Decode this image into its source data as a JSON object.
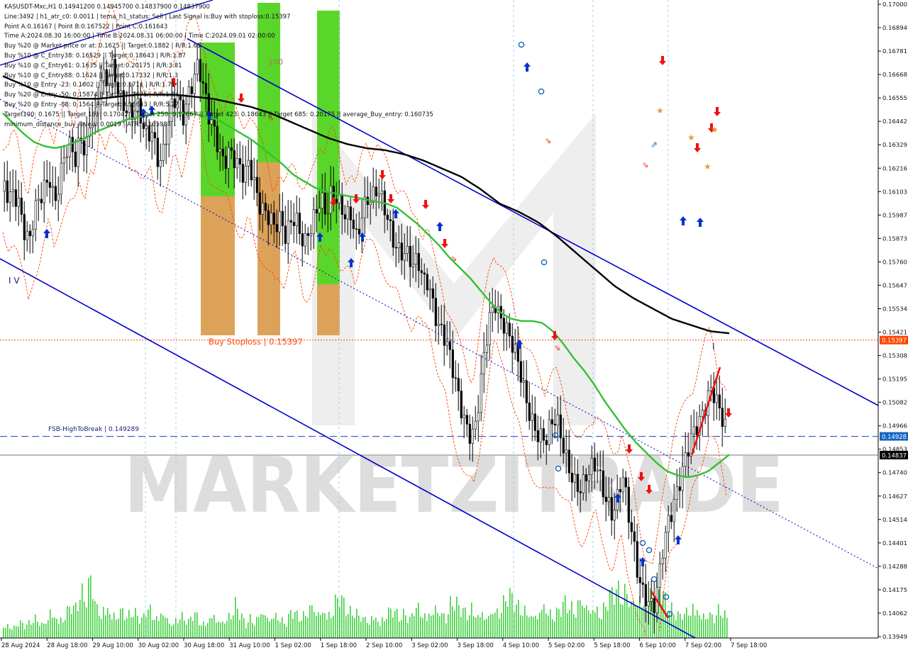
{
  "header": {
    "lines": [
      "KASUSDT-Mxc,H1  0.14941200 0.14945700 0.14837900 0.14837900",
      "Line:3492 | h1_atr_c0: 0.0011 | tema_h1_status: Sell | Last Signal is:Buy with stoploss:0.15397",
      "Point A:0.16167 | Point B:0.167522 | Point C:0.161643",
      "Time A:2024.08.30 16:00:00 | Time B:2024.08.31 06:00:00 | Time C:2024.09.01 02:00:00",
      "Buy %20 @ Market price or at: 0.1625 || Target:0.1882 | R/R:1.61",
      "Buy %10 @ C_Entry38: 0.16529 || Target:0.18643 | R/R:1.87",
      "Buy %10 @ C_Entry61: 0.1635 || Target:0.20175 | R/R:3.81",
      "Buy %10 @ C_Entry88: 0.1624 || Target:0.17332 | R/R:1.3",
      "Buy %10 @ Entry -23: 0.1602 || Target:0.1711 | R/R:1.71",
      "Buy %20 @ Entry -50: 0.15874 || Target:0.1675 | R/R:1.84",
      "Buy %20 @ Entry -88: 0.1564 || Target:0.16643 | R/R:5.27",
      "Target100: 0.1675 || Target 161: 0.17042 || Target 250: 0.17667 || Target 423: 0.18643 || Target 685: 0.20175 || average_Buy_entry: 0.160735",
      "minimum_distance_buy_levels: 0.0019 | ATR: 0.105984"
    ]
  },
  "watermark": {
    "text": "MARKETZITRADE"
  },
  "labels": {
    "buy_stoploss": "Buy Stoploss | 0.15397",
    "fsb": "FSB-HighToBreak | 0.149289",
    "wave_iv": "I V",
    "level_100": "100",
    "wave_i": "I"
  },
  "price_axis": {
    "ticks": [
      "0.17000",
      "0.16894",
      "0.16781",
      "0.16668",
      "0.16555",
      "0.16442",
      "0.16329",
      "0.16216",
      "0.16103",
      "0.15987",
      "0.15873",
      "0.15760",
      "0.15647",
      "0.15534",
      "0.15421",
      "0.15308",
      "0.15195",
      "0.15082",
      "0.14966",
      "0.14853",
      "0.14740",
      "0.14627",
      "0.14514",
      "0.14401",
      "0.14288",
      "0.14175",
      "0.14062",
      "0.13949"
    ],
    "badges": [
      {
        "text": "0.15397",
        "color": "#ff4500",
        "price": 0.15397
      },
      {
        "text": "0.14928",
        "color": "#1565c0",
        "price": 0.149289
      },
      {
        "text": "0.14837",
        "color": "#000000",
        "price": 0.148379
      }
    ]
  },
  "time_axis": {
    "ticks": [
      "28 Aug 2024",
      "28 Aug 18:00",
      "29 Aug 10:00",
      "30 Aug 02:00",
      "30 Aug 18:00",
      "31 Aug 10:00",
      "1 Sep 02:00",
      "1 Sep 18:00",
      "2 Sep 10:00",
      "3 Sep 02:00",
      "3 Sep 18:00",
      "4 Sep 10:00",
      "5 Sep 02:00",
      "5 Sep 18:00",
      "6 Sep 10:00",
      "7 Sep 02:00",
      "7 Sep 18:00"
    ]
  },
  "colors": {
    "bg": "#ffffff",
    "candle": "#000000",
    "ma_green": "#33c033",
    "ma_black": "#000000",
    "channel": "#0000cd",
    "envelope": "#ff4500",
    "buy_arrow": "#0033cc",
    "sell_arrow": "#ee1111",
    "zone_green": "#5ad62a",
    "zone_orange": "#dca25a",
    "volume": "#3fd03f",
    "stoploss": "#ff4500",
    "fsb": "#1f3fbf"
  },
  "chart_data": {
    "type": "candlestick",
    "symbol": "KASUSDT-Mxc",
    "timeframe": "H1",
    "ylim": [
      0.13949,
      0.1705
    ],
    "x": [
      "28 Aug 2024",
      "28 Aug 18:00",
      "29 Aug 10:00",
      "30 Aug 02:00",
      "30 Aug 18:00",
      "31 Aug 10:00",
      "1 Sep 02:00",
      "1 Sep 18:00",
      "2 Sep 10:00",
      "3 Sep 02:00",
      "3 Sep 18:00",
      "4 Sep 10:00",
      "5 Sep 02:00",
      "5 Sep 18:00",
      "6 Sep 10:00",
      "7 Sep 02:00",
      "7 Sep 18:00"
    ],
    "close_path": [
      0.1612,
      0.1608,
      0.1615,
      0.161,
      0.1595,
      0.1585,
      0.1598,
      0.1605,
      0.1615,
      0.1622,
      0.161,
      0.162,
      0.1628,
      0.163,
      0.1625,
      0.164,
      0.1635,
      0.1652,
      0.1645,
      0.1665,
      0.166,
      0.1672,
      0.1668,
      0.166,
      0.1655,
      0.1648,
      0.165,
      0.1642,
      0.1638,
      0.1645,
      0.1632,
      0.163,
      0.164,
      0.165,
      0.1655,
      0.1648,
      0.1662,
      0.167,
      0.1675,
      0.166,
      0.1645,
      0.164,
      0.1635,
      0.163,
      0.1635,
      0.1628,
      0.162,
      0.1615,
      0.1625,
      0.1618,
      0.161,
      0.1605,
      0.1598,
      0.159,
      0.1595,
      0.159,
      0.16,
      0.1605,
      0.1592,
      0.1585,
      0.159,
      0.1598,
      0.161,
      0.1605,
      0.1615,
      0.161,
      0.16,
      0.1595,
      0.1598,
      0.159,
      0.1605,
      0.1612,
      0.1608,
      0.161,
      0.1603,
      0.1598,
      0.1592,
      0.1588,
      0.1585,
      0.158,
      0.1572,
      0.1575,
      0.1568,
      0.1572,
      0.156,
      0.1548,
      0.154,
      0.153,
      0.152,
      0.1512,
      0.1505,
      0.1498,
      0.1495,
      0.151,
      0.153,
      0.1548,
      0.156,
      0.1555,
      0.155,
      0.154,
      0.153,
      0.152,
      0.151,
      0.1505,
      0.15,
      0.1495,
      0.149,
      0.1495,
      0.1498,
      0.1492,
      0.1485,
      0.1478,
      0.147,
      0.1465,
      0.147,
      0.1475,
      0.148,
      0.1472,
      0.1465,
      0.1455,
      0.146,
      0.147,
      0.1455,
      0.1445,
      0.143,
      0.142,
      0.1412,
      0.1405,
      0.1418,
      0.144,
      0.1455,
      0.1465,
      0.1472,
      0.1478,
      0.1485,
      0.1492,
      0.15,
      0.151,
      0.152,
      0.1515,
      0.1502,
      0.1494,
      0.1484
    ],
    "ma_green_path": [
      0.165,
      0.1645,
      0.164,
      0.1636,
      0.1634,
      0.1633,
      0.1634,
      0.1636,
      0.1638,
      0.1641,
      0.1643,
      0.1645,
      0.1647,
      0.1648,
      0.1649,
      0.165,
      0.165,
      0.165,
      0.165,
      0.1649,
      0.1648,
      0.1646,
      0.1643,
      0.164,
      0.1637,
      0.1633,
      0.1629,
      0.1625,
      0.162,
      0.1617,
      0.1614,
      0.1612,
      0.1611,
      0.161,
      0.1609,
      0.1608,
      0.1607,
      0.1606,
      0.1604,
      0.16,
      0.1596,
      0.1591,
      0.1586,
      0.158,
      0.1575,
      0.157,
      0.1564,
      0.1558,
      0.1553,
      0.155,
      0.1549,
      0.1549,
      0.1548,
      0.1544,
      0.1538,
      0.1531,
      0.1525,
      0.1518,
      0.151,
      0.1503,
      0.1496,
      0.149,
      0.1485,
      0.148,
      0.1476,
      0.1474,
      0.1473,
      0.1474,
      0.1476,
      0.148,
      0.1484
    ],
    "ma_black_path": [
      0.1668,
      0.1664,
      0.166,
      0.1658,
      0.1657,
      0.1657,
      0.1658,
      0.1659,
      0.1659,
      0.1659,
      0.1658,
      0.1657,
      0.1655,
      0.1653,
      0.165,
      0.1646,
      0.1642,
      0.1638,
      0.1635,
      0.1633,
      0.1632,
      0.163,
      0.1627,
      0.1623,
      0.1619,
      0.1613,
      0.1606,
      0.1602,
      0.1597,
      0.159,
      0.1582,
      0.1574,
      0.1566,
      0.156,
      0.1555,
      0.155,
      0.1547,
      0.1544,
      0.1543
    ],
    "channel_upper": [
      [
        0.0,
        0.17
      ],
      [
        1.0,
        0.1485
      ]
    ],
    "channel_lower": [
      [
        0.0,
        0.1578
      ],
      [
        0.76,
        0.139
      ]
    ],
    "channel_mid": [
      [
        0.0,
        0.165
      ],
      [
        1.0,
        0.1425
      ]
    ],
    "stoploss": 0.15397,
    "fsb_high_to_break": 0.149289,
    "last_price": 0.148379,
    "volume_path": [
      0.1,
      0.12,
      0.09,
      0.15,
      0.11,
      0.13,
      0.18,
      0.14,
      0.12,
      0.25,
      0.2,
      0.16,
      0.22,
      0.3,
      0.26,
      0.4,
      0.35,
      0.55,
      0.28,
      0.24,
      0.3,
      0.22,
      0.2,
      0.26,
      0.18,
      0.24,
      0.2,
      0.16,
      0.3,
      0.22,
      0.18,
      0.26,
      0.15,
      0.12,
      0.2,
      0.18,
      0.14,
      0.24,
      0.16,
      0.12,
      0.18,
      0.22,
      0.14,
      0.16,
      0.2,
      0.3,
      0.22,
      0.12,
      0.18,
      0.15,
      0.25,
      0.2,
      0.18,
      0.22,
      0.16,
      0.14,
      0.26,
      0.2,
      0.18,
      0.24,
      0.3,
      0.22,
      0.26,
      0.2,
      0.28,
      0.4,
      0.32,
      0.22,
      0.24,
      0.2,
      0.18,
      0.16,
      0.22,
      0.14,
      0.2,
      0.26,
      0.24,
      0.18,
      0.22,
      0.16,
      0.3,
      0.26,
      0.2,
      0.24,
      0.28,
      0.22,
      0.18,
      0.34,
      0.3,
      0.26,
      0.22,
      0.28,
      0.2,
      0.24,
      0.18,
      0.26,
      0.22,
      0.3,
      0.4,
      0.34,
      0.28,
      0.26,
      0.22,
      0.2,
      0.24,
      0.3,
      0.22,
      0.2,
      0.26,
      0.32,
      0.28,
      0.24,
      0.36,
      0.3,
      0.26,
      0.28,
      0.22,
      0.32,
      0.4,
      0.44,
      0.36,
      0.42,
      0.3,
      0.38,
      0.34,
      0.28,
      0.5,
      0.45,
      0.4,
      0.28,
      0.24,
      0.2,
      0.22,
      0.26,
      0.3,
      0.24,
      0.2,
      0.22,
      0.18,
      0.26,
      0.2,
      0.16
    ]
  }
}
